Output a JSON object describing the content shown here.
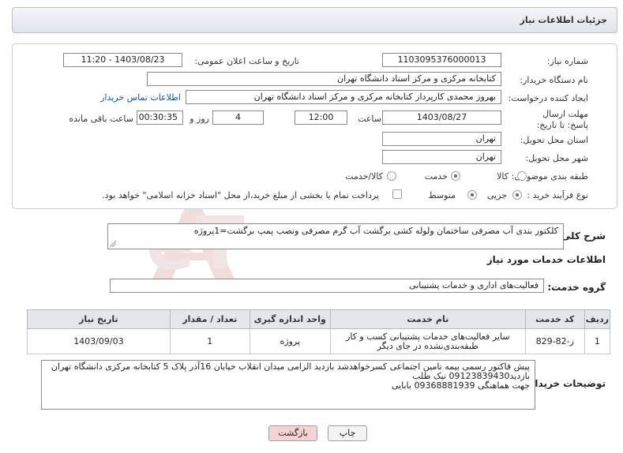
{
  "header": {
    "title": "جزئیات اطلاعات نیاز"
  },
  "need_number": {
    "label": "شماره نیاز:",
    "value": "1103095376000013"
  },
  "announce": {
    "label": "تاریخ و ساعت اعلان عمومی:",
    "value": "1403/08/23 - 11:20"
  },
  "buyer_org": {
    "label": "نام دستگاه خریدار:",
    "value": "کتابخانه مرکزی و مرکز اسناد دانشگاه تهران"
  },
  "creator": {
    "label": "ایجاد کننده درخواست:",
    "value": "بهروز محمدی کارپرداز کتابخانه مرکزی و مرکز اسناد دانشگاه تهران",
    "contact_link": "اطلاعات تماس خریدار"
  },
  "deadline": {
    "label": "مهلت ارسال پاسخ: تا تاریخ:",
    "date": "1403/08/27",
    "time_label": "ساعت",
    "time": "12:00",
    "days": "4",
    "days_label": "روز و",
    "remaining": "00:30:35",
    "remaining_label": "ساعت باقی مانده"
  },
  "province": {
    "label": "استان محل تحویل:",
    "value": "تهران"
  },
  "city": {
    "label": "شهر محل تحویل:",
    "value": "تهران"
  },
  "category": {
    "label": "طبقه بندی موضوعی:",
    "options": [
      "کالا",
      "خدمت",
      "کالا/خدمت"
    ],
    "selected": "خدمت"
  },
  "process": {
    "label": "نوع فرآیند خرید :",
    "options": [
      "جزیی",
      "متوسط"
    ],
    "selected": "جزیی",
    "note": "پرداخت تمام یا بخشی از مبلغ خرید،از محل \"اسناد خزانه اسلامی\" خواهد بود."
  },
  "summary": {
    "label": "شرح کلی نیاز:",
    "value": "کلکتور بندی آب مصرفی ساختمان ولوله کشی برگشت آب گرم مصرفی ونصب پمپ برگشت=1پروژه"
  },
  "services_heading": "اطلاعات خدمات مورد نیاز",
  "service_group": {
    "label": "گروه خدمت:",
    "value": "فعالیت‌های اداری و خدمات پشتیبانی"
  },
  "table": {
    "headers": [
      "ردیف",
      "کد خدمت",
      "نام خدمت",
      "واحد اندازه گیری",
      "تعداد / مقدار",
      "تاریخ نیاز"
    ],
    "rows": [
      [
        "1",
        "ز-82-829",
        "سایر فعالیت‌های خدمات پشتیبانی کسب و کار طبقه‌بندی‌نشده در جای دیگر",
        "پروژه",
        "1",
        "1403/09/03"
      ]
    ]
  },
  "buyer_desc": {
    "label": "توضیحات خریدار:",
    "lines": [
      "پیش فاکتور رسمی بیمه تامین اجتماعی کسرخواهدشد بازدید الزامی میدان انقلاب خیابان 16آذر پلاک 5 کتابخانه مرکزی دانشگاه تهران",
      "بازدید09123839430 نیک طلب",
      "جهت هماهنگی 09368881939 بابایی"
    ]
  },
  "buttons": {
    "print": "چاپ",
    "back": "بازگشت"
  },
  "watermark": {
    "text": "AriaTender.neT"
  },
  "colors": {
    "back_button": "#f6d3d3",
    "link": "#1a4fa8",
    "header_bg": "#e0e4ea",
    "watermark": "#e3b9b9"
  }
}
